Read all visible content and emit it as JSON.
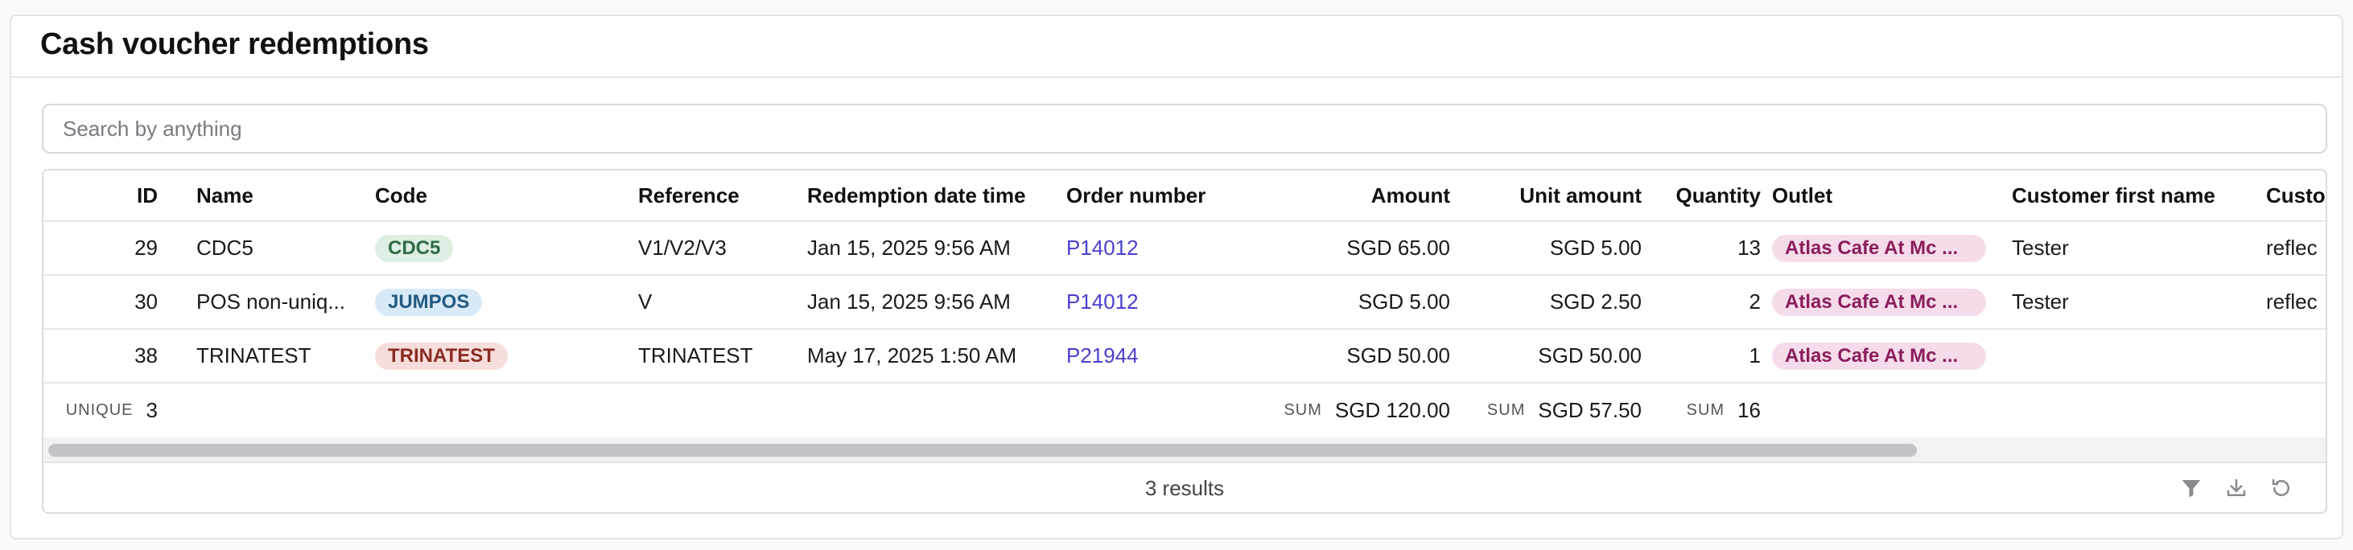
{
  "page": {
    "title": "Cash voucher redemptions"
  },
  "search": {
    "placeholder": "Search by anything",
    "value": ""
  },
  "table": {
    "columns": [
      "ID",
      "Name",
      "Code",
      "Reference",
      "Redemption date time",
      "Order number",
      "Amount",
      "Unit amount",
      "Quantity",
      "Outlet",
      "Customer first name",
      "Custo"
    ],
    "rows": [
      {
        "id": "29",
        "name": "CDC5",
        "code": "CDC5",
        "code_color": "green",
        "reference": "V1/V2/V3",
        "datetime": "Jan 15, 2025 9:56 AM",
        "order": "P14012",
        "amount": "SGD 65.00",
        "unit_amount": "SGD 5.00",
        "quantity": "13",
        "outlet": "Atlas Cafe At Mc ...",
        "first_name": "Tester",
        "customer_extra": "reflec"
      },
      {
        "id": "30",
        "name": "POS non-uniq...",
        "code": "JUMPOS",
        "code_color": "blue",
        "reference": "V",
        "datetime": "Jan 15, 2025 9:56 AM",
        "order": "P14012",
        "amount": "SGD 5.00",
        "unit_amount": "SGD 2.50",
        "quantity": "2",
        "outlet": "Atlas Cafe At Mc ...",
        "first_name": "Tester",
        "customer_extra": "reflec"
      },
      {
        "id": "38",
        "name": "TRINATEST",
        "code": "TRINATEST",
        "code_color": "red",
        "reference": "TRINATEST",
        "datetime": "May 17, 2025 1:50 AM",
        "order": "P21944",
        "amount": "SGD 50.00",
        "unit_amount": "SGD 50.00",
        "quantity": "1",
        "outlet": "Atlas Cafe At Mc ...",
        "first_name": "",
        "customer_extra": ""
      }
    ],
    "aggregates": {
      "id_label": "UNIQUE",
      "id_value": "3",
      "amount_label": "SUM",
      "amount_value": "SGD 120.00",
      "unit_amount_label": "SUM",
      "unit_amount_value": "SGD 57.50",
      "quantity_label": "SUM",
      "quantity_value": "16"
    },
    "footer": {
      "results": "3 results",
      "icons": [
        "filter-icon",
        "download-icon",
        "reset-icon"
      ]
    }
  }
}
